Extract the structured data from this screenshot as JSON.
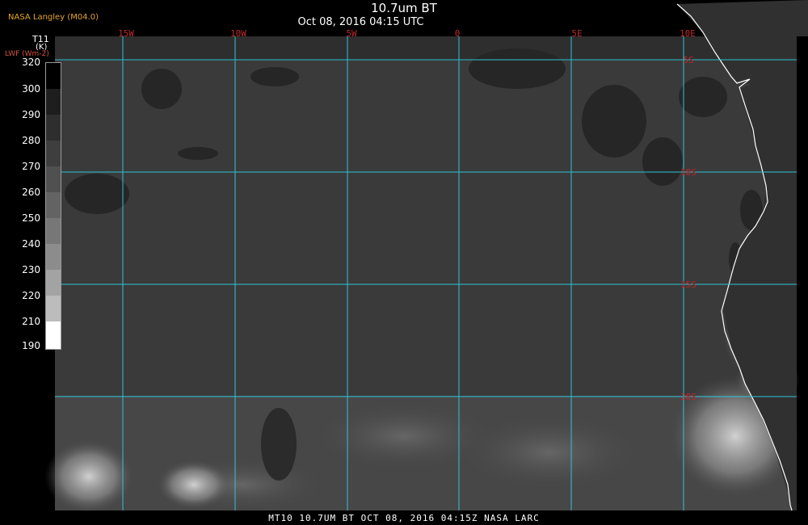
{
  "header": {
    "title": "10.7um BT",
    "subtitle": "Oct 08, 2016 04:15 UTC",
    "producer": "NASA Langley (M04.0)"
  },
  "colorbar": {
    "variable": "T11",
    "unit": "(K)",
    "alt_label": "LWF (Wm-2)",
    "ticks": [
      "320",
      "300",
      "290",
      "280",
      "270",
      "260",
      "250",
      "240",
      "230",
      "220",
      "210",
      "190"
    ]
  },
  "map": {
    "longitude_labels": [
      "15W",
      "10W",
      "5W",
      "0",
      "5E",
      "10E"
    ],
    "latitude_labels": [
      "5S",
      "10S",
      "15S",
      "20S"
    ],
    "grid_color": "#2ec4d6",
    "lat_label_color": "#c0292a",
    "lon_label_color": "#c0292a",
    "coastline_color": "#ffffff"
  },
  "footer": {
    "label": "MT10  10.7UM BT   OCT 08, 2016 04:15Z  NASA LARC"
  }
}
